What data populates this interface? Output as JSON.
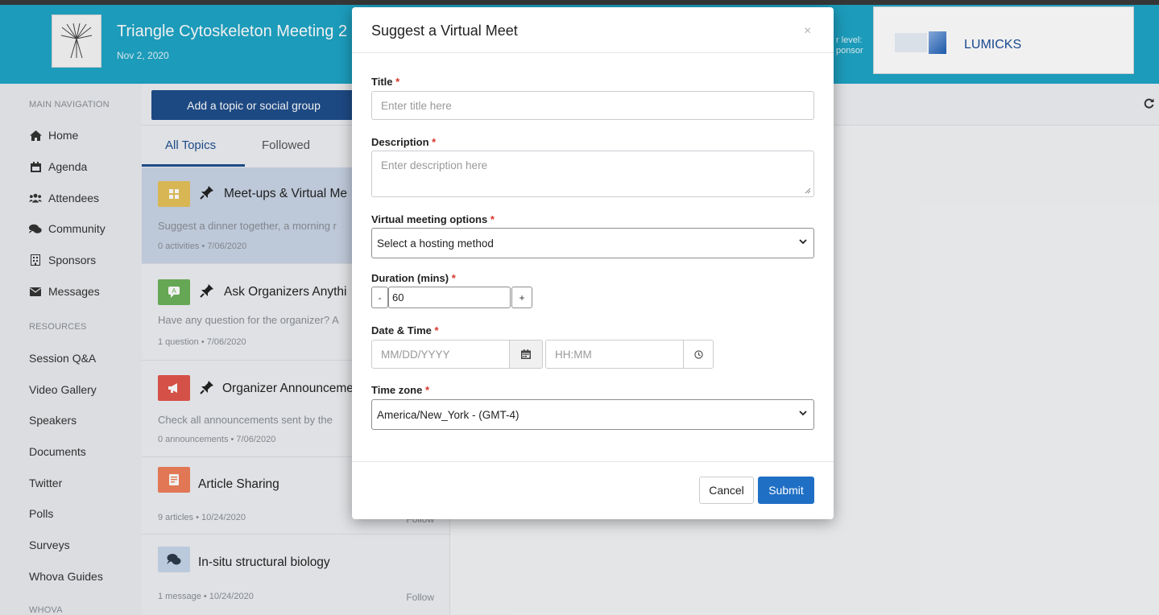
{
  "header": {
    "event_title": "Triangle Cytoskeleton Meeting 2",
    "event_date": "Nov 2, 2020",
    "sponsor_level_line1": "r level:",
    "sponsor_level_line2": "ponsor",
    "sponsor_name": "LUMICKS",
    "bg_color": "#1ea5c6"
  },
  "sidebar": {
    "main_nav_heading": "MAIN NAVIGATION",
    "items": [
      {
        "label": "Home",
        "icon": "home-icon"
      },
      {
        "label": "Agenda",
        "icon": "calendar-icon"
      },
      {
        "label": "Attendees",
        "icon": "users-icon"
      },
      {
        "label": "Community",
        "icon": "comments-icon"
      },
      {
        "label": "Sponsors",
        "icon": "building-icon"
      },
      {
        "label": "Messages",
        "icon": "envelope-icon"
      }
    ],
    "resources_heading": "RESOURCES",
    "resources": [
      "Session Q&A",
      "Video Gallery",
      "Speakers",
      "Documents",
      "Twitter",
      "Polls",
      "Surveys",
      "Whova Guides"
    ],
    "footer_heading": "WHOVA"
  },
  "topics": {
    "add_button": "Add a topic or social group",
    "tabs": [
      "All Topics",
      "Followed"
    ],
    "items": [
      {
        "title": "Meet-ups & Virtual Me",
        "desc": "Suggest a dinner together, a morning r",
        "meta": "0 activities  •  7/06/2020",
        "color": "#e6c25a",
        "pinned": true
      },
      {
        "title": "Ask Organizers Anythi",
        "desc": "Have any question for the organizer? A",
        "meta": "1 question  •  7/06/2020",
        "color": "#6cb25a",
        "pinned": true
      },
      {
        "title": "Organizer Announceme",
        "desc": "Check all announcements sent by the",
        "meta": "0 announcements  •  7/06/2020",
        "color": "#e2574c",
        "pinned": true
      },
      {
        "title": "Article Sharing",
        "desc": "",
        "meta": "9 articles  •  10/24/2020",
        "follow": "Follow",
        "color": "#f07f5a",
        "pinned": false
      },
      {
        "title": "In-situ structural biology",
        "desc": "",
        "meta": "1 message  •  10/24/2020",
        "follow": "Follow",
        "color": "#c7d6ea",
        "pinned": false
      }
    ]
  },
  "modal": {
    "title": "Suggest a Virtual Meet",
    "close": "×",
    "required_mark": "*",
    "fields": {
      "title_label": "Title",
      "title_placeholder": "Enter title here",
      "description_label": "Description",
      "description_placeholder": "Enter description here",
      "options_label": "Virtual meeting options",
      "options_value": "Select a hosting method",
      "duration_label": "Duration (mins)",
      "duration_minus": "-",
      "duration_value": "60",
      "duration_plus": "+",
      "datetime_label": "Date & Time",
      "date_placeholder": "MM/DD/YYYY",
      "time_placeholder": "HH:MM",
      "timezone_label": "Time zone",
      "timezone_value": "America/New_York - (GMT-4)"
    },
    "cancel": "Cancel",
    "submit": "Submit",
    "submit_color": "#1f6fc5"
  }
}
